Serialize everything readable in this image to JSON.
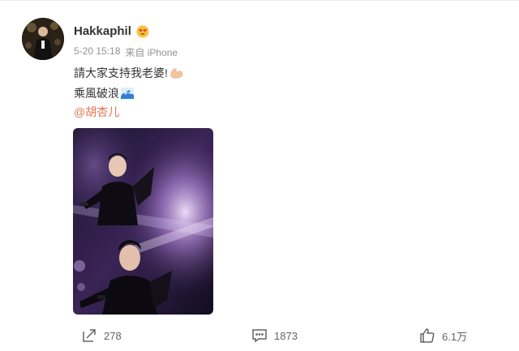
{
  "post": {
    "author": {
      "name": "Hakkaphil",
      "avatar_icon": "user-avatar-photo",
      "badge_icon": "heart-eyes-emoji-icon"
    },
    "meta": {
      "time": "5-20 15:18",
      "source": "来自 iPhone"
    },
    "lines": [
      {
        "text": "請大家支持我老婆!",
        "emoji": "flexed-biceps-emoji-icon"
      },
      {
        "text": "乘風破浪",
        "emoji": "water-wave-emoji-icon"
      }
    ],
    "mention": "@胡杏儿",
    "photo": {
      "icon": "stage-performance-photo"
    },
    "actions": {
      "forward": {
        "icon": "share-forward-icon",
        "count": "278"
      },
      "comment": {
        "icon": "comment-icon",
        "count": "1873"
      },
      "like": {
        "icon": "thumbs-up-icon",
        "count": "6.1万"
      }
    },
    "colors": {
      "accent": "#eb7350",
      "text": "#333333",
      "meta": "#939393"
    }
  }
}
